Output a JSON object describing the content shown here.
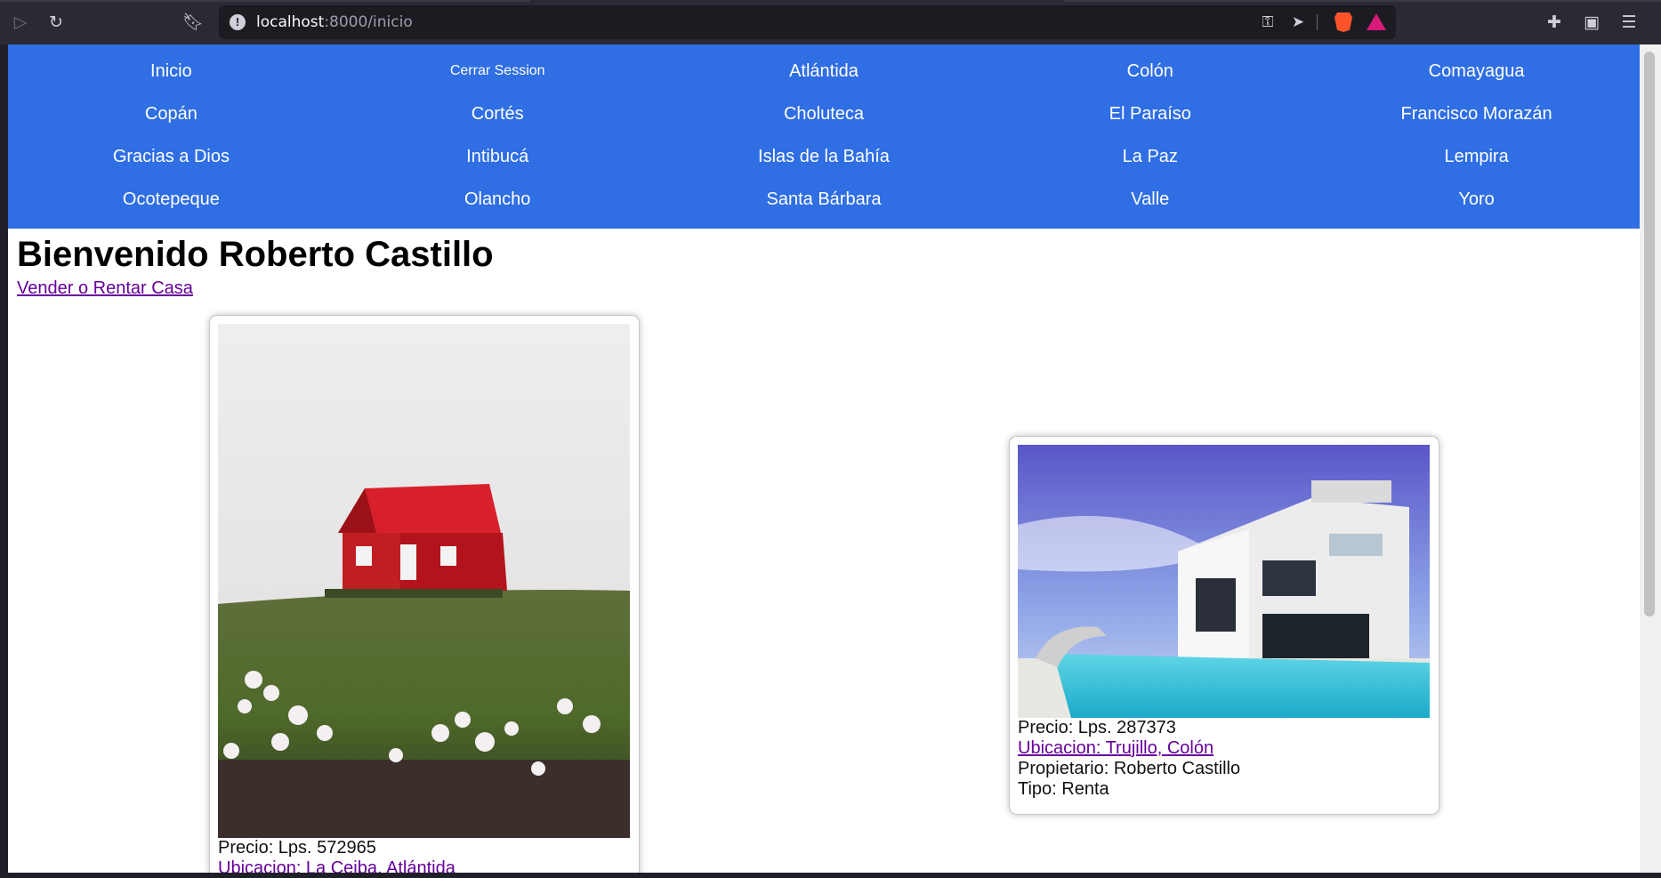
{
  "browser": {
    "url_host": "localhost",
    "url_path": ":8000/inicio"
  },
  "nav": {
    "items": [
      {
        "label": "Inicio"
      },
      {
        "label": "Cerrar Session"
      },
      {
        "label": "Atlántida"
      },
      {
        "label": "Colón"
      },
      {
        "label": "Comayagua"
      },
      {
        "label": "Copán"
      },
      {
        "label": "Cortés"
      },
      {
        "label": "Choluteca"
      },
      {
        "label": "El Paraíso"
      },
      {
        "label": "Francisco Morazán"
      },
      {
        "label": "Gracias a Dios"
      },
      {
        "label": "Intibucá"
      },
      {
        "label": "Islas de la Bahía"
      },
      {
        "label": "La Paz"
      },
      {
        "label": "Lempira"
      },
      {
        "label": "Ocotepeque"
      },
      {
        "label": "Olancho"
      },
      {
        "label": "Santa Bárbara"
      },
      {
        "label": "Valle"
      },
      {
        "label": "Yoro"
      }
    ]
  },
  "main": {
    "welcome": "Bienvenido Roberto Castillo",
    "sell_link": "Vender o Rentar Casa",
    "listings": [
      {
        "price": "Precio: Lps. 572965",
        "location": "Ubicacion: La Ceiba, Atlántida"
      },
      {
        "price": "Precio: Lps. 287373",
        "location": "Ubicacion: Trujillo, Colón",
        "owner": "Propietario: Roberto Castillo",
        "type": "Tipo: Renta"
      }
    ]
  }
}
